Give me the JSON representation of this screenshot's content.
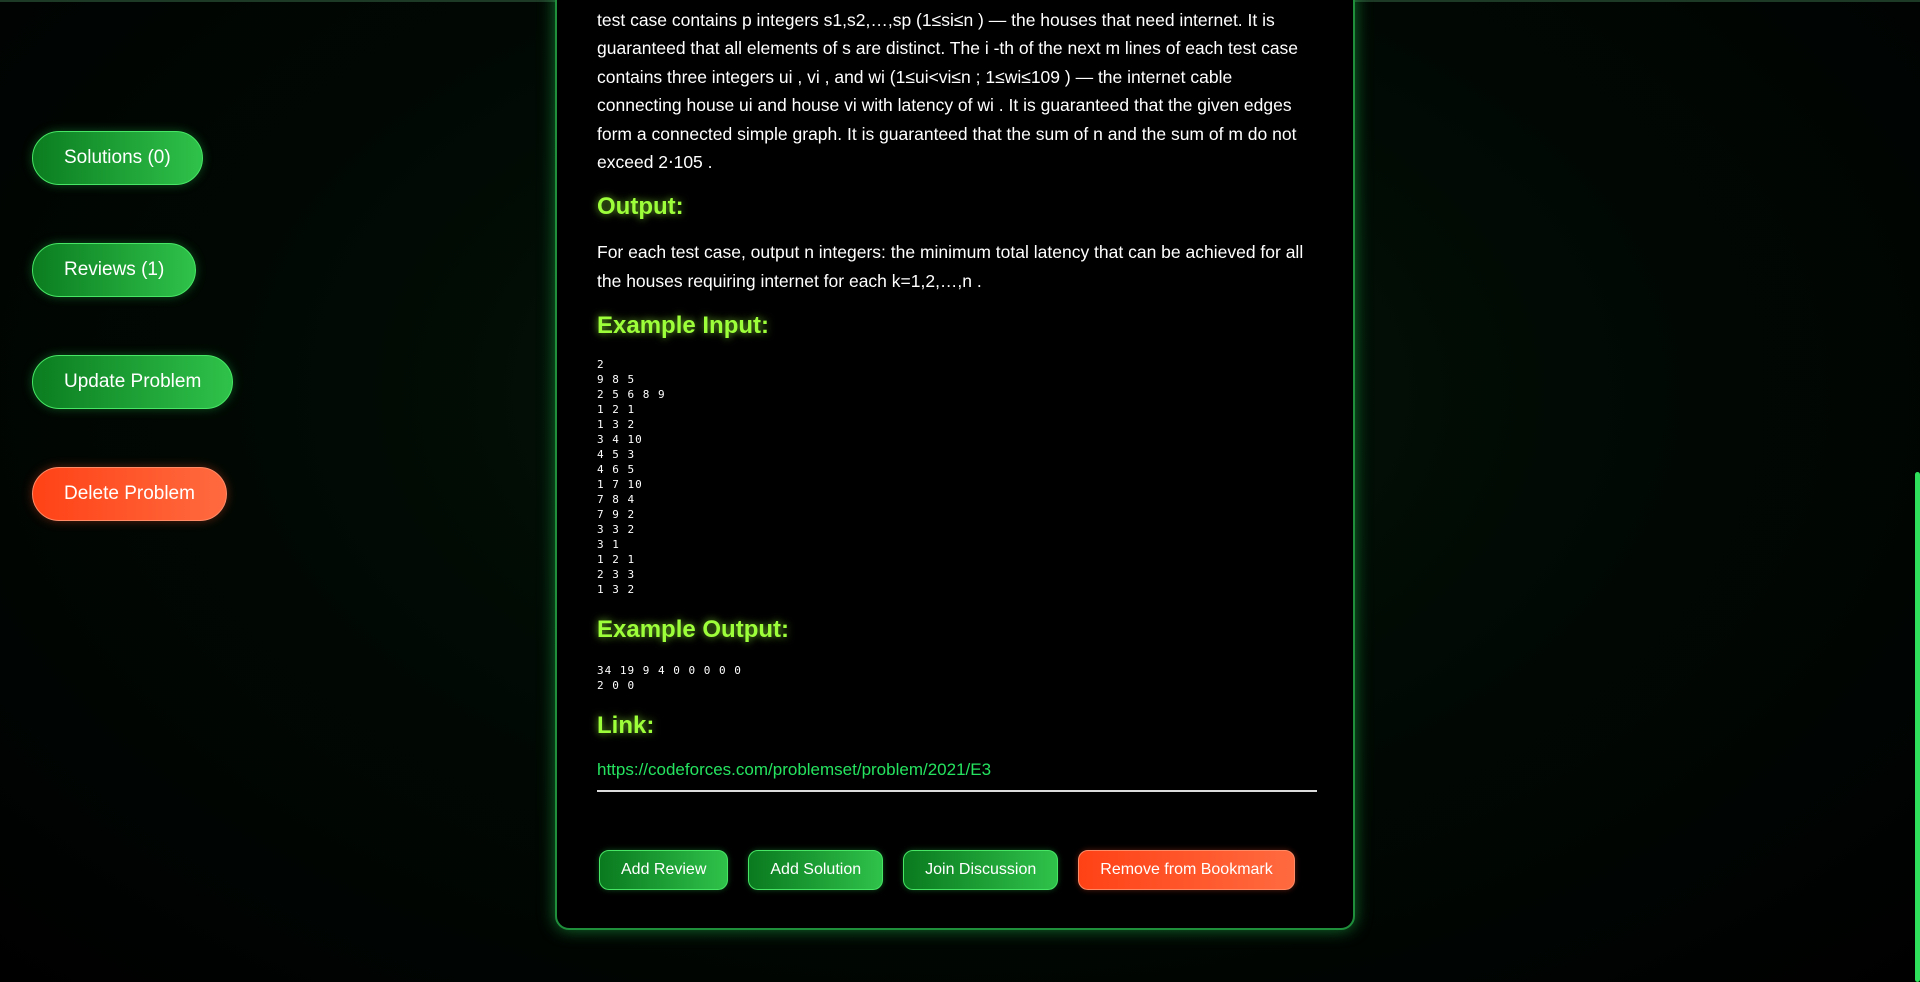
{
  "sidebar": {
    "solutions": "Solutions (0)",
    "reviews": "Reviews (1)",
    "update": "Update Problem",
    "delete": "Delete Problem"
  },
  "problem": {
    "input_text_lines": [
      "test case contains p integers s1,s2,…,sp (1≤si≤n ) — the houses that need internet. It is",
      "guaranteed that all elements of s are distinct. The i -th of the next m lines of each test case",
      "contains three integers ui , vi , and wi (1≤ui<vi≤n ; 1≤wi≤109 ) — the internet cable",
      "connecting house ui and house vi with latency of wi . It is guaranteed that the given edges",
      "form a connected simple graph. It is guaranteed that the sum of n and the sum of m do not",
      "exceed 2⋅105 ."
    ],
    "output_heading": "Output:",
    "output_text_lines": [
      "For each test case, output n integers: the minimum total latency that can be achieved for all",
      "the houses requiring internet for each k=1,2,…,n ."
    ],
    "example_input_heading": "Example Input:",
    "example_input": "2\n9 8 5\n2 5 6 8 9\n1 2 1\n1 3 2\n3 4 10\n4 5 3\n4 6 5\n1 7 10\n7 8 4\n7 9 2\n3 3 2\n3 1\n1 2 1\n2 3 3\n1 3 2",
    "example_output_heading": "Example Output:",
    "example_output": "34 19 9 4 0 0 0 0 0\n2 0 0",
    "link_heading": "Link:",
    "link_url": "https://codeforces.com/problemset/problem/2021/E3"
  },
  "actions": {
    "add_review": "Add Review",
    "add_solution": "Add Solution",
    "join_discussion": "Join Discussion",
    "remove_bookmark": "Remove from Bookmark"
  },
  "colors": {
    "accent_green": "#2fc24a",
    "heading_lime": "#9dff3a",
    "link_green": "#25e35f",
    "danger_orange": "#ff4f24"
  }
}
